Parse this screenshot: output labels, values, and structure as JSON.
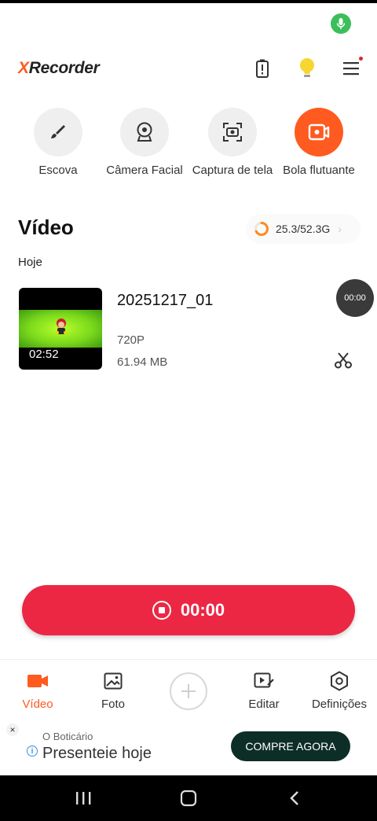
{
  "app": {
    "logo_prefix": "X",
    "logo_rest": "Recorder"
  },
  "colors": {
    "accent": "#ff5a1f",
    "record": "#ec2744",
    "ad_cta": "#0d2e27",
    "mic": "#3bbf5a"
  },
  "tools": [
    {
      "label": "Escova",
      "icon": "brush-icon"
    },
    {
      "label": "Câmera Facial",
      "icon": "webcam-icon"
    },
    {
      "label": "Captura de tela",
      "icon": "screenshot-icon"
    },
    {
      "label": "Bola flutuante",
      "icon": "floating-ball-icon"
    }
  ],
  "videos_section": {
    "title": "Vídeo",
    "storage": "25.3/52.3G",
    "day": "Hoje"
  },
  "video": {
    "name": "20251217_01",
    "duration": "02:52",
    "resolution": "720P",
    "size": "61.94 MB"
  },
  "floating_timer": "00:00",
  "record": {
    "time": "00:00"
  },
  "nav": [
    {
      "label": "Vídeo",
      "icon": "video-camera-icon",
      "active": true
    },
    {
      "label": "Foto",
      "icon": "photo-icon",
      "active": false
    },
    {
      "label": "",
      "icon": "plus-icon",
      "active": false
    },
    {
      "label": "Editar",
      "icon": "edit-video-icon",
      "active": false
    },
    {
      "label": "Definições",
      "icon": "settings-icon",
      "active": false
    }
  ],
  "ad": {
    "brand": "O Boticário",
    "title": "Presenteie hoje",
    "cta": "COMPRE AGORA",
    "close": "×",
    "info": "i"
  }
}
